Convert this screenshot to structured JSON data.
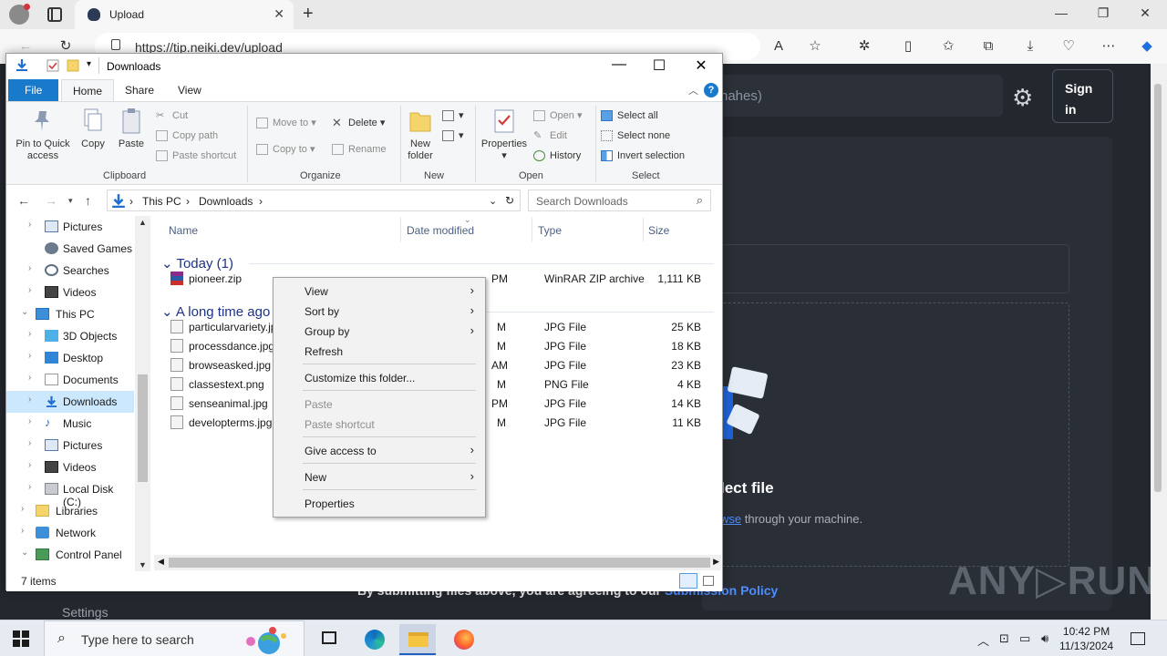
{
  "browser": {
    "tab_title": "Upload",
    "tab_close": "✕",
    "new_tab": "+",
    "url": "https://tip.neiki.dev/upload",
    "minimize": "—",
    "restore": "❐",
    "close": "✕"
  },
  "webpage": {
    "search_partial": "nahes)",
    "signin_line1": "Sign",
    "signin_line2": "in",
    "select_file": "lect file",
    "browse_partial": "wse",
    "browse_rest": " through your machine.",
    "policy_text": "By submitting files above, you are agreeing to our ",
    "policy_link": "Submission Policy",
    "settings_label": "Settings",
    "watermark": "ANY▷RUN"
  },
  "explorer": {
    "title": "Downloads",
    "ribbon_tabs": [
      "File",
      "Home",
      "Share",
      "View"
    ],
    "clipboard": {
      "pin_line1": "Pin to Quick",
      "pin_line2": "access",
      "copy": "Copy",
      "paste": "Paste",
      "cut": "Cut",
      "copy_path": "Copy path",
      "paste_shortcut": "Paste shortcut",
      "group": "Clipboard"
    },
    "organize": {
      "move_to": "Move to",
      "copy_to": "Copy to",
      "delete": "Delete",
      "rename": "Rename",
      "group": "Organize"
    },
    "new": {
      "new_folder_line1": "New",
      "new_folder_line2": "folder",
      "group": "New"
    },
    "open": {
      "properties": "Properties",
      "open": "Open",
      "edit": "Edit",
      "history": "History",
      "group": "Open"
    },
    "select": {
      "select_all": "Select all",
      "select_none": "Select none",
      "invert": "Invert selection",
      "group": "Select"
    },
    "address": {
      "crumb1": "This PC",
      "crumb2": "Downloads",
      "sep": "›"
    },
    "search_placeholder": "Search Downloads",
    "nav_items": [
      {
        "label": "Pictures"
      },
      {
        "label": "Saved Games"
      },
      {
        "label": "Searches"
      },
      {
        "label": "Videos"
      },
      {
        "label": "This PC"
      },
      {
        "label": "3D Objects"
      },
      {
        "label": "Desktop"
      },
      {
        "label": "Documents"
      },
      {
        "label": "Downloads"
      },
      {
        "label": "Music"
      },
      {
        "label": "Pictures"
      },
      {
        "label": "Videos"
      },
      {
        "label": "Local Disk (C:)"
      },
      {
        "label": "Libraries"
      },
      {
        "label": "Network"
      },
      {
        "label": "Control Panel"
      }
    ],
    "columns": {
      "name": "Name",
      "date": "Date modified",
      "type": "Type",
      "size": "Size"
    },
    "groups": {
      "today": "Today (1)",
      "long_ago": "A long time ago"
    },
    "files_today": [
      {
        "name": "pioneer.zip",
        "date": "PM",
        "type": "WinRAR ZIP archive",
        "size": "1,111 KB"
      }
    ],
    "files_old": [
      {
        "name": "particularvariety.jpg",
        "date": "M",
        "type": "JPG File",
        "size": "25 KB"
      },
      {
        "name": "processdance.jpg",
        "date": "M",
        "type": "JPG File",
        "size": "18 KB"
      },
      {
        "name": "browseasked.jpg",
        "date": "AM",
        "type": "JPG File",
        "size": "23 KB"
      },
      {
        "name": "classestext.png",
        "date": "M",
        "type": "PNG File",
        "size": "4 KB"
      },
      {
        "name": "senseanimal.jpg",
        "date": "PM",
        "type": "JPG File",
        "size": "14 KB"
      },
      {
        "name": "developterms.jpg",
        "date": "M",
        "type": "JPG File",
        "size": "11 KB"
      }
    ],
    "status": "7 items"
  },
  "context_menu": {
    "view": "View",
    "sort_by": "Sort by",
    "group_by": "Group by",
    "refresh": "Refresh",
    "customize": "Customize this folder...",
    "paste": "Paste",
    "paste_shortcut": "Paste shortcut",
    "give_access": "Give access to",
    "new": "New",
    "properties": "Properties",
    "arrow": "›"
  },
  "taskbar": {
    "search_text": "Type here to search",
    "time": "10:42 PM",
    "date": "11/13/2024"
  },
  "colors": {
    "explorer_accent": "#1979ca",
    "selected_nav": "#cce8ff",
    "page_bg": "#23272e",
    "link": "#4c8dff"
  }
}
